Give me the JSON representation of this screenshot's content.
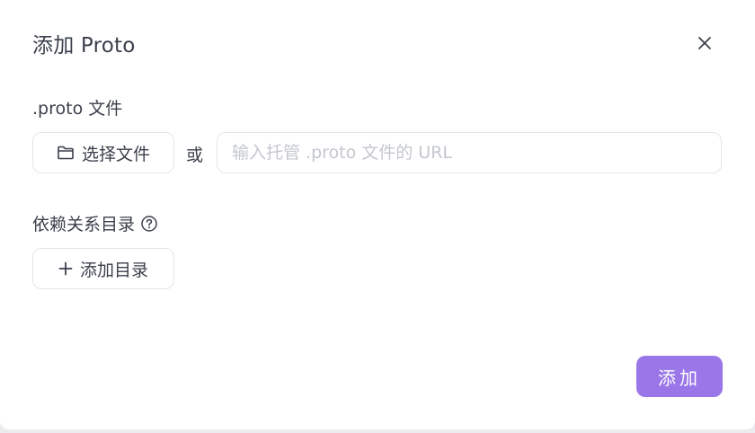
{
  "dialog": {
    "title": "添加 Proto",
    "close_icon": "close-icon"
  },
  "proto_file": {
    "label": ".proto 文件",
    "choose_button_label": "选择文件",
    "choose_button_icon": "folder-icon",
    "or_text": "或",
    "url_placeholder": "输入托管 .proto 文件的 URL",
    "url_value": ""
  },
  "dependencies": {
    "label": "依赖关系目录",
    "help_icon": "help-circle-icon",
    "add_button_label": "添加目录",
    "add_button_icon": "plus-icon"
  },
  "footer": {
    "submit_label": "添加"
  },
  "colors": {
    "primary": "#9a76e8",
    "text": "#3a3f4b",
    "placeholder": "#c4c7cf",
    "border": "#e3e5ea"
  }
}
